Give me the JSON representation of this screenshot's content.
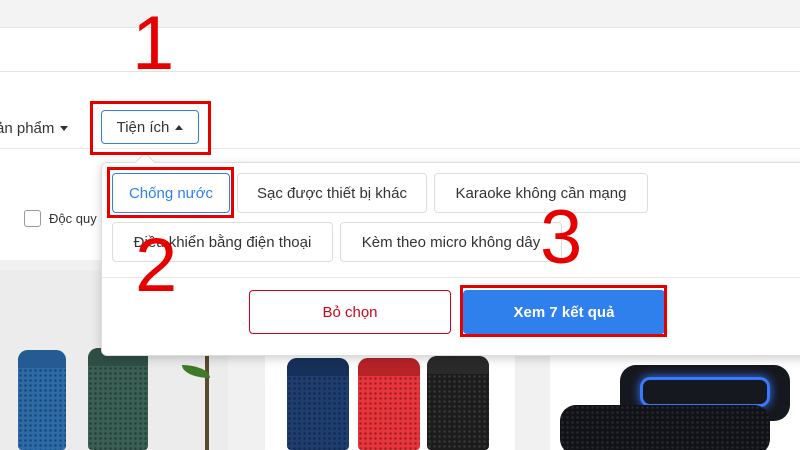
{
  "filters": {
    "partial_label": "ản phẩm",
    "open_label": "Tiện ích"
  },
  "checkbox_label": "Độc quy",
  "dropdown": {
    "options": [
      "Chống nước",
      "Sạc được thiết bị khác",
      "Karaoke không cần mạng",
      "Điều khiển bằng điện thoại",
      "Kèm theo micro không dây"
    ],
    "selected": "Chống nước",
    "clear_label": "Bỏ chọn",
    "view_label": "Xem 7 kết quả"
  },
  "annotations": [
    "1",
    "2",
    "3"
  ],
  "colors": {
    "accent": "#2f80ed",
    "danger": "#d0021b",
    "annotation": "#e60000"
  }
}
